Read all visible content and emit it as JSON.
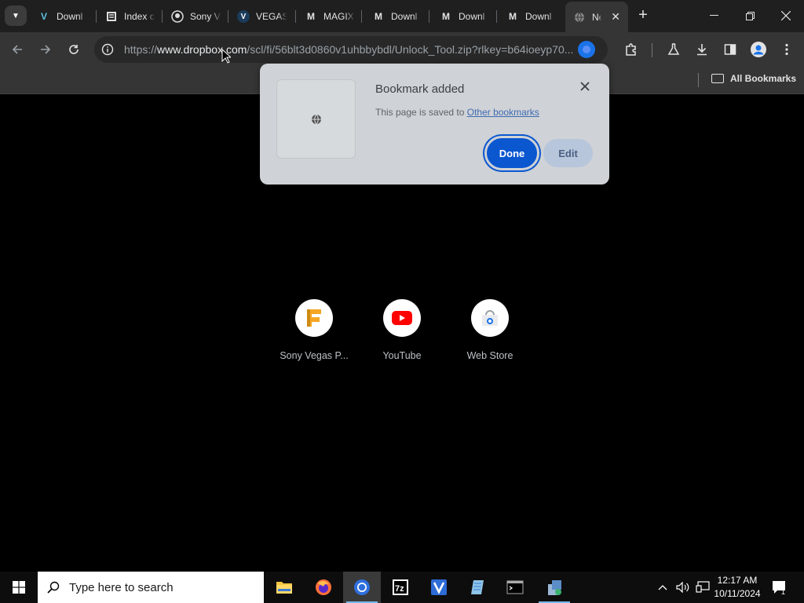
{
  "tabs": [
    {
      "title": "Downl",
      "favicon": "vegas-icon"
    },
    {
      "title": "Index c",
      "favicon": "index-icon"
    },
    {
      "title": "Sony V",
      "favicon": "github-icon"
    },
    {
      "title": "VEGAS",
      "favicon": "vegas-v-icon"
    },
    {
      "title": "MAGIX",
      "favicon": "magix-icon"
    },
    {
      "title": "Downl",
      "favicon": "magix-icon"
    },
    {
      "title": "Downl",
      "favicon": "magix-icon"
    },
    {
      "title": "Downl",
      "favicon": "magix-icon"
    },
    {
      "title": "Ne",
      "favicon": "globe-icon"
    }
  ],
  "toolbar": {
    "url_prefix": "https://",
    "url_host": "www.dropbox.com",
    "url_rest": "/scl/fi/56blt3d0860v1uhbbybdl/Unlock_Tool.zip?rlkey=b64ioeyp70..."
  },
  "bookmarks_bar": {
    "all_bookmarks": "All Bookmarks"
  },
  "bubble": {
    "title": "Bookmark added",
    "desc_prefix": "This page is saved to ",
    "folder_link": "Other bookmarks",
    "done": "Done",
    "edit": "Edit"
  },
  "shortcuts": [
    {
      "label": "Sony Vegas P...",
      "icon": "vegas-f-icon"
    },
    {
      "label": "YouTube",
      "icon": "youtube-icon"
    },
    {
      "label": "Web Store",
      "icon": "webstore-icon"
    }
  ],
  "taskbar": {
    "search_placeholder": "Type here to search",
    "time": "12:17 AM",
    "date": "10/11/2024",
    "notification_count": "1"
  },
  "colors": {
    "accent": "#0b57d0",
    "link": "#3f6bb3",
    "youtube_red": "#ff0000",
    "vegas_orange": "#f5a623"
  }
}
